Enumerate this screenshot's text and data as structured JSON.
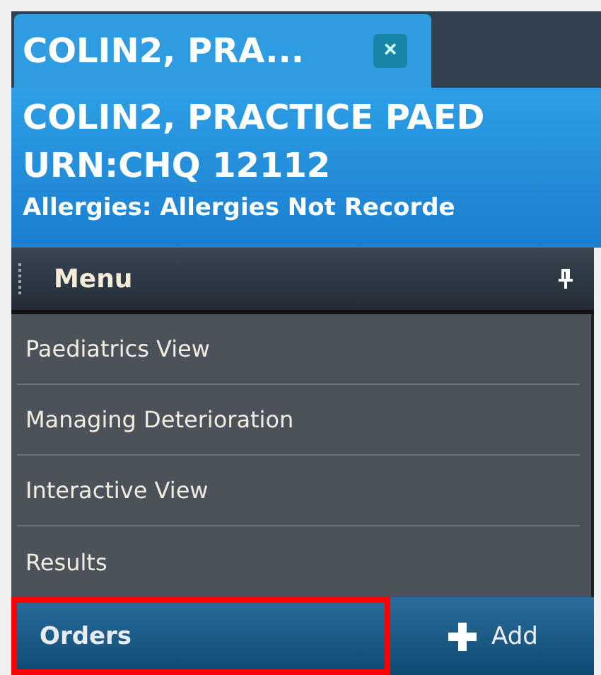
{
  "tab": {
    "label": "COLIN2, PRA...",
    "selected": true,
    "close": "×"
  },
  "banner": {
    "name": "COLIN2, PRACTICE PAED",
    "urn": "URN:CHQ 12112",
    "allergies": "Allergies: Allergies Not Recorde"
  },
  "menu": {
    "title": "Menu",
    "items": [
      {
        "label": "Paediatrics View"
      },
      {
        "label": "Managing Deterioration"
      },
      {
        "label": "Interactive View"
      },
      {
        "label": "Results"
      }
    ]
  },
  "orders": {
    "label": "Orders",
    "highlighted": true
  },
  "add_button": {
    "label": "Add"
  }
}
